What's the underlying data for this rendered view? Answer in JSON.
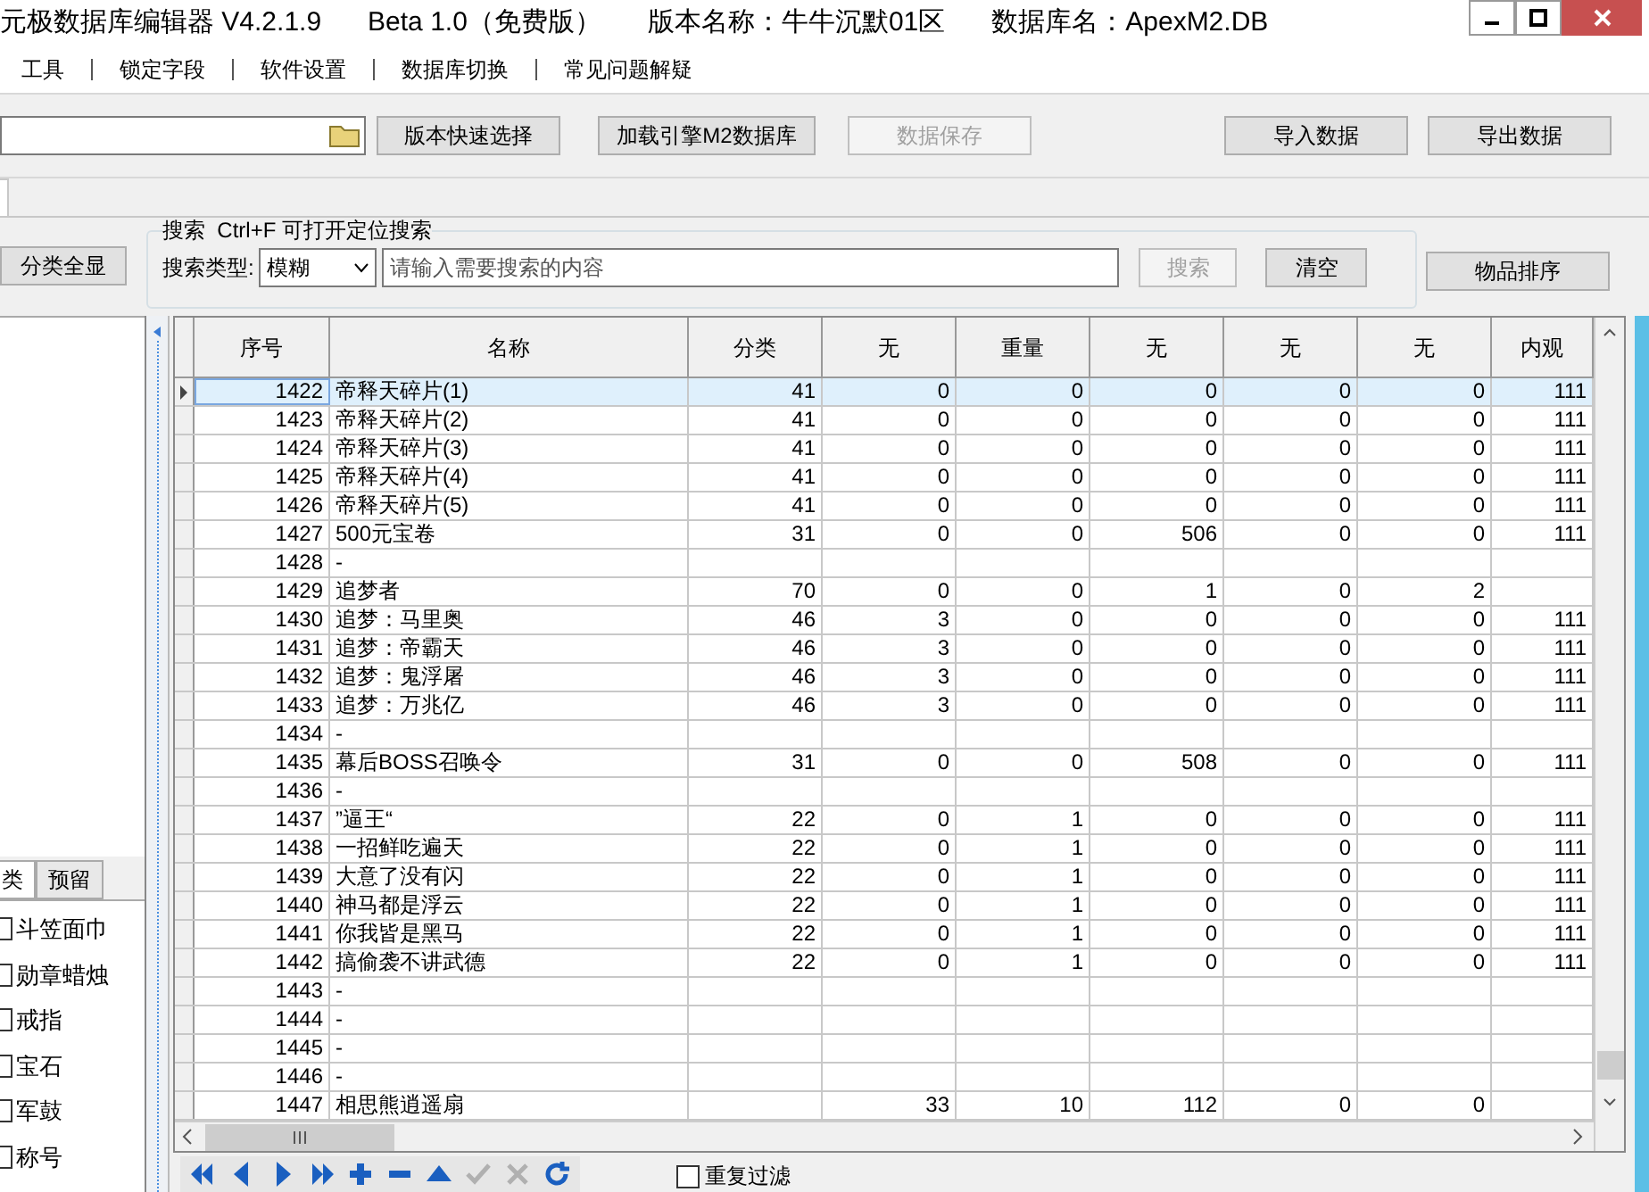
{
  "window": {
    "title_parts": [
      "元极数据库编辑器 V4.2.1.9",
      "Beta 1.0（免费版）",
      "版本名称：牛牛沉默01区",
      "数据库名：ApexM2.DB"
    ]
  },
  "menu": [
    "工具",
    "锁定字段",
    "软件设置",
    "数据库切换",
    "常见问题解疑"
  ],
  "toolbar": {
    "buttons": [
      {
        "label": "版本快速选择",
        "disabled": false
      },
      {
        "label": "加载引擎M2数据库",
        "disabled": false
      },
      {
        "label": "数据保存",
        "disabled": true
      },
      {
        "label": "导入数据",
        "disabled": false
      },
      {
        "label": "导出数据",
        "disabled": false
      }
    ]
  },
  "show_all_button": "分类全显",
  "search": {
    "hint": "搜索  Ctrl+F 可打开定位搜索",
    "type_label": "搜索类型:",
    "type_value": "模糊",
    "placeholder": "请输入需要搜索的内容",
    "search_button": {
      "label": "搜索",
      "disabled": true
    },
    "clear_button": "清空"
  },
  "sort_button": "物品排序",
  "left_panel": {
    "tabs": [
      {
        "label": "类",
        "selected": true
      },
      {
        "label": "预留",
        "selected": false
      }
    ],
    "items": [
      {
        "label": "斗笠面巾",
        "checked": false
      },
      {
        "label": "勋章蜡烛",
        "checked": false
      },
      {
        "label": "戒指",
        "checked": false
      },
      {
        "label": "宝石",
        "checked": false
      },
      {
        "label": "军鼓",
        "checked": false
      },
      {
        "label": "称号",
        "checked": false
      }
    ]
  },
  "table": {
    "columns": [
      "序号",
      "名称",
      "分类",
      "无",
      "重量",
      "无",
      "无",
      "无",
      "内观"
    ],
    "rows": [
      {
        "selected": true,
        "cells": [
          "1422",
          "帝释天碎片(1)",
          "41",
          "0",
          "0",
          "0",
          "0",
          "0",
          "111"
        ]
      },
      {
        "selected": false,
        "cells": [
          "1423",
          "帝释天碎片(2)",
          "41",
          "0",
          "0",
          "0",
          "0",
          "0",
          "111"
        ]
      },
      {
        "selected": false,
        "cells": [
          "1424",
          "帝释天碎片(3)",
          "41",
          "0",
          "0",
          "0",
          "0",
          "0",
          "111"
        ]
      },
      {
        "selected": false,
        "cells": [
          "1425",
          "帝释天碎片(4)",
          "41",
          "0",
          "0",
          "0",
          "0",
          "0",
          "111"
        ]
      },
      {
        "selected": false,
        "cells": [
          "1426",
          "帝释天碎片(5)",
          "41",
          "0",
          "0",
          "0",
          "0",
          "0",
          "111"
        ]
      },
      {
        "selected": false,
        "cells": [
          "1427",
          "500元宝卷",
          "31",
          "0",
          "0",
          "506",
          "0",
          "0",
          "111"
        ]
      },
      {
        "selected": false,
        "cells": [
          "1428",
          "-",
          null,
          null,
          null,
          null,
          null,
          null,
          null
        ]
      },
      {
        "selected": false,
        "cells": [
          "1429",
          "追梦者",
          "70",
          "0",
          "0",
          "1",
          "0",
          "2",
          null
        ]
      },
      {
        "selected": false,
        "cells": [
          "1430",
          "追梦：马里奥",
          "46",
          "3",
          "0",
          "0",
          "0",
          "0",
          "111"
        ]
      },
      {
        "selected": false,
        "cells": [
          "1431",
          "追梦：帝霸天",
          "46",
          "3",
          "0",
          "0",
          "0",
          "0",
          "111"
        ]
      },
      {
        "selected": false,
        "cells": [
          "1432",
          "追梦：鬼浮屠",
          "46",
          "3",
          "0",
          "0",
          "0",
          "0",
          "111"
        ]
      },
      {
        "selected": false,
        "cells": [
          "1433",
          "追梦：万兆亿",
          "46",
          "3",
          "0",
          "0",
          "0",
          "0",
          "111"
        ]
      },
      {
        "selected": false,
        "cells": [
          "1434",
          "-",
          null,
          null,
          null,
          null,
          null,
          null,
          null
        ]
      },
      {
        "selected": false,
        "cells": [
          "1435",
          "幕后BOSS召唤令",
          "31",
          "0",
          "0",
          "508",
          "0",
          "0",
          "111"
        ]
      },
      {
        "selected": false,
        "cells": [
          "1436",
          "-",
          null,
          null,
          null,
          null,
          null,
          null,
          null
        ]
      },
      {
        "selected": false,
        "cells": [
          "1437",
          "”逼王“",
          "22",
          "0",
          "1",
          "0",
          "0",
          "0",
          "111"
        ]
      },
      {
        "selected": false,
        "cells": [
          "1438",
          "一招鲜吃遍天",
          "22",
          "0",
          "1",
          "0",
          "0",
          "0",
          "111"
        ]
      },
      {
        "selected": false,
        "cells": [
          "1439",
          "大意了没有闪",
          "22",
          "0",
          "1",
          "0",
          "0",
          "0",
          "111"
        ]
      },
      {
        "selected": false,
        "cells": [
          "1440",
          "神马都是浮云",
          "22",
          "0",
          "1",
          "0",
          "0",
          "0",
          "111"
        ]
      },
      {
        "selected": false,
        "cells": [
          "1441",
          "你我皆是黑马",
          "22",
          "0",
          "1",
          "0",
          "0",
          "0",
          "111"
        ]
      },
      {
        "selected": false,
        "cells": [
          "1442",
          "搞偷袭不讲武德",
          "22",
          "0",
          "1",
          "0",
          "0",
          "0",
          "111"
        ]
      },
      {
        "selected": false,
        "cells": [
          "1443",
          "-",
          null,
          null,
          null,
          null,
          null,
          null,
          null
        ]
      },
      {
        "selected": false,
        "cells": [
          "1444",
          "-",
          null,
          null,
          null,
          null,
          null,
          null,
          null
        ]
      },
      {
        "selected": false,
        "cells": [
          "1445",
          "-",
          null,
          null,
          null,
          null,
          null,
          null,
          null
        ]
      },
      {
        "selected": false,
        "cells": [
          "1446",
          "-",
          null,
          null,
          null,
          null,
          null,
          null,
          null
        ]
      },
      {
        "selected": false,
        "cells": [
          "1447",
          "相思熊逍遥扇",
          null,
          "33",
          "10",
          "112",
          "0",
          "0",
          null
        ]
      }
    ]
  },
  "nav_buttons": [
    {
      "kind": "first",
      "disabled": false
    },
    {
      "kind": "prior",
      "disabled": false
    },
    {
      "kind": "next",
      "disabled": false
    },
    {
      "kind": "last",
      "disabled": false
    },
    {
      "kind": "insert",
      "disabled": false
    },
    {
      "kind": "delete",
      "disabled": false
    },
    {
      "kind": "edit",
      "disabled": false
    },
    {
      "kind": "post",
      "disabled": true
    },
    {
      "kind": "cancel",
      "disabled": true
    },
    {
      "kind": "refresh",
      "disabled": false
    }
  ],
  "dedupe_filter": {
    "label": "重复过滤",
    "checked": false
  }
}
